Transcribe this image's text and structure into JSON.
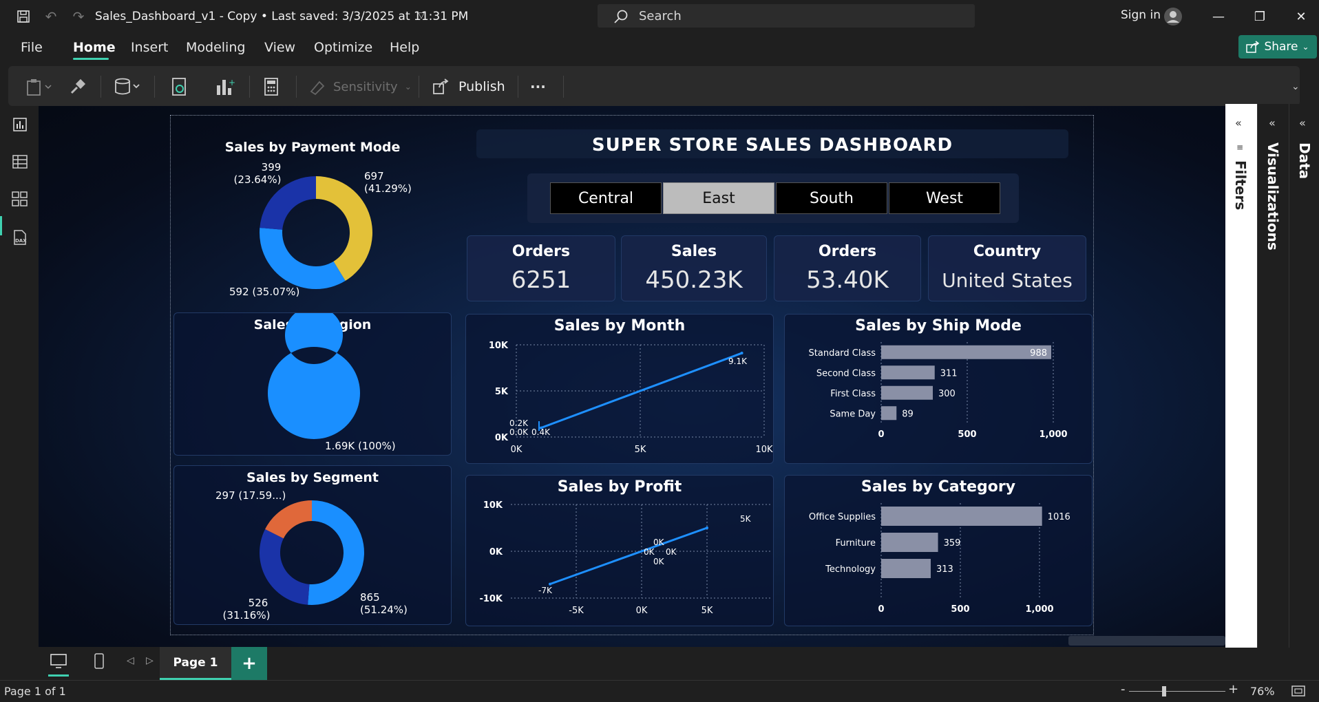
{
  "title_bar": {
    "doc_title": "Sales_Dashboard_v1 - Copy • Last saved: 3/3/2025 at 11:31 PM",
    "search_placeholder": "Search",
    "sign_in": "Sign in"
  },
  "menu": {
    "items": [
      "File",
      "Home",
      "Insert",
      "Modeling",
      "View",
      "Optimize",
      "Help"
    ],
    "active": "Home",
    "share": "Share"
  },
  "ribbon": {
    "sensitivity": "Sensitivity",
    "publish": "Publish",
    "more": "···"
  },
  "right_panes": {
    "filters": "Filters",
    "visualizations": "Visualizations",
    "data": "Data"
  },
  "page_tabs": {
    "current": "Page 1",
    "add": "+"
  },
  "status": {
    "page_info": "Page 1 of 1",
    "zoom": "76%",
    "minus": "-",
    "plus": "+"
  },
  "dashboard": {
    "title": "SUPER STORE SALES DASHBOARD",
    "region_buttons": [
      "Central",
      "East",
      "South",
      "West"
    ],
    "selected_region": "East",
    "kpis": [
      {
        "label": "Orders",
        "value": "6251"
      },
      {
        "label": "Sales",
        "value": "450.23K"
      },
      {
        "label": "Orders",
        "value": "53.40K"
      },
      {
        "label": "Country",
        "value": "United States"
      }
    ]
  },
  "chart_data": [
    {
      "type": "pie",
      "title": "Sales by Payment Mode",
      "slices": [
        {
          "value": 697,
          "label": "697",
          "pct": "(41.29%)",
          "color": "#e3c139"
        },
        {
          "value": 592,
          "label": "592 (35.07%)",
          "pct": "",
          "color": "#1a8fff"
        },
        {
          "value": 399,
          "label": "399",
          "pct": "(23.64%)",
          "color": "#1a33a8"
        }
      ]
    },
    {
      "type": "pie",
      "title": "Sales by Region",
      "slices": [
        {
          "value": 1690,
          "label": "1.69K (100%)",
          "pct": "",
          "color": "#1a8fff"
        }
      ]
    },
    {
      "type": "pie",
      "title": "Sales by Segment",
      "slices": [
        {
          "value": 865,
          "label": "865",
          "pct": "(51.24%)",
          "color": "#1a8fff"
        },
        {
          "value": 526,
          "label": "526",
          "pct": "(31.16%)",
          "color": "#1a33a8"
        },
        {
          "value": 297,
          "label": "297 (17.59...)",
          "pct": "",
          "color": "#e0683a"
        }
      ]
    },
    {
      "type": "scatter",
      "title": "Sales by Month",
      "xlim": [
        0,
        10000
      ],
      "ylim": [
        0,
        10000
      ],
      "x_ticks": [
        "0K",
        "5K",
        "10K"
      ],
      "y_ticks": [
        "0K",
        "5K",
        "10K"
      ],
      "xlabel": "",
      "ylabel": "",
      "points": [
        {
          "x": 1000,
          "y": 1000
        },
        {
          "x": 9100,
          "y": 9100
        }
      ],
      "point_labels": [
        "0.2K",
        "0.0K",
        "0.4K",
        "9.1K"
      ],
      "color": "#1e90ff"
    },
    {
      "type": "scatter",
      "title": "Sales by Profit",
      "xlim": [
        -10000,
        10000
      ],
      "ylim": [
        -10000,
        10000
      ],
      "x_ticks": [
        "-5K",
        "0K",
        "5K"
      ],
      "y_ticks": [
        "-10K",
        "0K",
        "10K"
      ],
      "xlabel": "",
      "ylabel": "",
      "points": [
        {
          "x": -7000,
          "y": -7000
        },
        {
          "x": 5000,
          "y": 5000
        }
      ],
      "point_labels": [
        "-7K",
        "0K",
        "0K",
        "0K",
        "0K",
        "5K"
      ],
      "color": "#1e90ff"
    },
    {
      "type": "bar",
      "title": "Sales by Ship Mode",
      "orientation": "horizontal",
      "categories": [
        "Standard Class",
        "Second Class",
        "First Class",
        "Same Day"
      ],
      "values": [
        988,
        311,
        300,
        89
      ],
      "xlim": [
        0,
        1000
      ],
      "x_ticks": [
        "0",
        "500",
        "1,000"
      ],
      "color": "#8a90a6"
    },
    {
      "type": "bar",
      "title": "Sales by Category",
      "orientation": "horizontal",
      "categories": [
        "Office Supplies",
        "Furniture",
        "Technology"
      ],
      "values": [
        1016,
        359,
        313
      ],
      "xlim": [
        0,
        1000
      ],
      "x_ticks": [
        "0",
        "500",
        "1,000"
      ],
      "color": "#8a90a6"
    }
  ]
}
